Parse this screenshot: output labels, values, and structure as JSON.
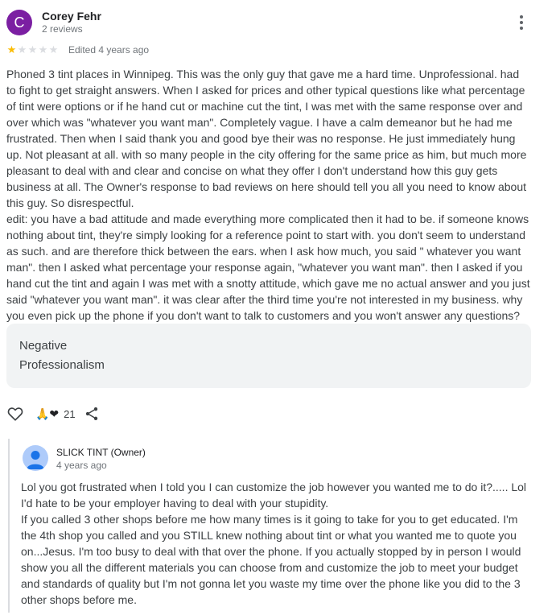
{
  "review": {
    "author": {
      "initial": "C",
      "name": "Corey Fehr",
      "reviews": "2 reviews",
      "avatar_color": "#7b1fa2"
    },
    "rating": {
      "stars": 1,
      "out_of": 5,
      "filled_star": "★",
      "empty_star": "★"
    },
    "edited": "Edited 4 years ago",
    "more_icon": "more-vert-icon",
    "text": "Phoned 3 tint places in Winnipeg. This was the only guy that gave me a hard time. Unprofessional. had to fight to get straight answers. When I asked for prices and other typical questions like what percentage of tint were options or if he hand cut or machine cut the tint, I was met with the same response over and over which was \"whatever you want man\". Completely vague. I have a calm demeanor but he had me frustrated. Then when I said thank you and good bye their was no response. He just immediately hung up. Not pleasant at all. with so many people in the city offering for the same price as him, but much more pleasant to deal with and clear and concise on what they offer I don't understand how this guy gets business at all. The Owner's response to bad reviews on here should tell you all you need to know about this guy. So disrespectful.\nedit: you have a bad attitude and made everything more complicated then it had to be. if someone knows nothing about tint, they're simply looking for a reference point to start with. you don't seem to understand as such. and are therefore thick between the ears. when I ask how much, you said \" whatever you want man\". then I asked what percentage your response again, \"whatever you want man\". then I asked if you hand cut the tint and again I was met with a snotty attitude, which gave me no actual answer and you just said \"whatever you want man\". it was clear after the third time you're not interested in my business. why you even pick up the phone if you don't want to talk to customers and you won't answer any questions?",
    "tags": [
      "Negative",
      "Professionalism"
    ],
    "actions": {
      "reactions_emoji": "🙏❤",
      "reaction_count": "21",
      "like_icon": "heart-outline-icon",
      "share_icon": "share-icon"
    }
  },
  "owner_response": {
    "name": "SLICK TINT (Owner)",
    "time": "4 years ago",
    "text": "Lol you got frustrated when I told you I can customize the job however you wanted me to do it?..... Lol I'd hate to be your employer having to deal with your stupidity.\nIf you called 3 other shops before me how many times is it going to take for you to get educated. I'm the 4th shop you called and you STILL knew nothing about tint or what you wanted me to quote you on...Jesus. I'm too busy to deal with that over the phone. If you actually stopped by in person I would show you all the different materials you can choose from and customize the job to meet your budget and standards of quality but I'm not gonna let you waste my time over the phone like you did to the 3 other shops before me."
  }
}
